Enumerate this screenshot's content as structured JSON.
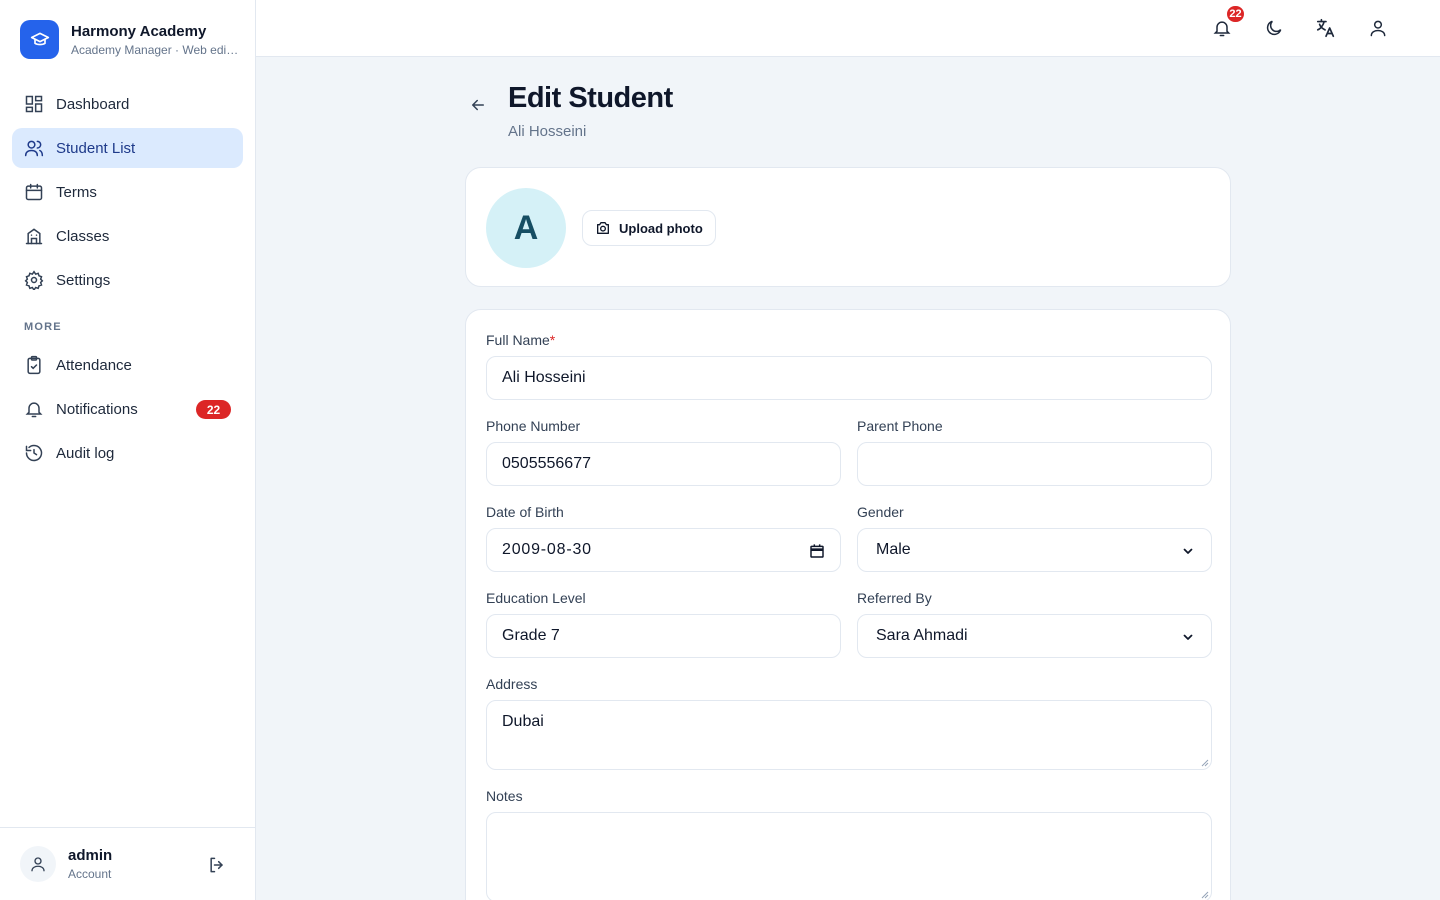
{
  "brand": {
    "name": "Harmony Academy",
    "subtitle": "Academy Manager · Web edit..."
  },
  "sidebar": {
    "items": [
      {
        "label": "Dashboard",
        "icon": "dashboard-icon"
      },
      {
        "label": "Student List",
        "icon": "users-icon",
        "active": true
      },
      {
        "label": "Terms",
        "icon": "calendar-icon"
      },
      {
        "label": "Classes",
        "icon": "building-icon"
      },
      {
        "label": "Settings",
        "icon": "gear-icon"
      }
    ],
    "more_title": "MORE",
    "more_items": [
      {
        "label": "Attendance",
        "icon": "clipboard-icon"
      },
      {
        "label": "Notifications",
        "icon": "bell-icon",
        "badge": "22"
      },
      {
        "label": "Audit log",
        "icon": "history-icon"
      }
    ]
  },
  "user": {
    "name": "admin",
    "role": "Account"
  },
  "topbar": {
    "notification_count": "22"
  },
  "header": {
    "title": "Edit Student",
    "subtitle": "Ali Hosseini"
  },
  "photo": {
    "initial": "A",
    "upload_label": "Upload photo"
  },
  "form": {
    "full_name": {
      "label": "Full Name",
      "required_mark": "*",
      "value": "Ali Hosseini"
    },
    "phone": {
      "label": "Phone Number",
      "value": "0505556677"
    },
    "parent_phone": {
      "label": "Parent Phone",
      "value": ""
    },
    "dob": {
      "label": "Date of Birth",
      "value": "2009-08-30"
    },
    "gender": {
      "label": "Gender",
      "value": "Male"
    },
    "education": {
      "label": "Education Level",
      "value": "Grade 7"
    },
    "referred_by": {
      "label": "Referred By",
      "value": "Sara Ahmadi"
    },
    "address": {
      "label": "Address",
      "value": "Dubai"
    },
    "notes": {
      "label": "Notes",
      "value": ""
    }
  },
  "colors": {
    "accent": "#2563eb",
    "active_bg": "#dbeafe",
    "badge": "#dc2626",
    "avatar_bg": "#d5f1f7"
  }
}
